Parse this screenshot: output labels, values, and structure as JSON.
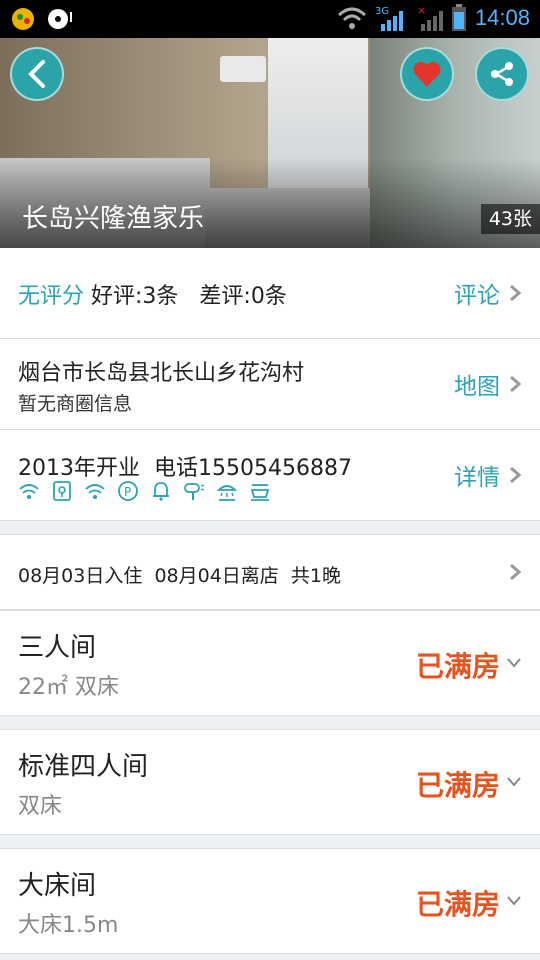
{
  "status_bar": {
    "time": "14:08",
    "network": "3G"
  },
  "hero": {
    "hotel_name": "长岛兴隆渔家乐",
    "photo_count": "43张"
  },
  "rating": {
    "no_score": "无评分",
    "good": "好评:3条",
    "bad": "差评:0条",
    "link": "评论"
  },
  "address": {
    "main": "烟台市长岛县北长山乡花沟村",
    "sub": "暂无商圈信息",
    "link": "地图"
  },
  "info": {
    "opened": "2013年开业",
    "phone": "电话15505456887",
    "link": "详情",
    "amenities": [
      "wifi-icon",
      "safe-icon",
      "wifi-icon",
      "parking-icon",
      "bell-icon",
      "hairdryer-icon",
      "shower-icon",
      "bathtub-icon"
    ]
  },
  "dates": {
    "checkin": "08月03日入住",
    "checkout": "08月04日离店",
    "nights": "共1晚"
  },
  "rooms": [
    {
      "name": "三人间",
      "desc": "22㎡ 双床",
      "status": "已满房"
    },
    {
      "name": "标准四人间",
      "desc": "双床",
      "status": "已满房"
    },
    {
      "name": "大床间",
      "desc": "大床1.5m",
      "status": "已满房"
    }
  ],
  "colors": {
    "accent": "#2aa3b5",
    "full": "#e8531d"
  }
}
